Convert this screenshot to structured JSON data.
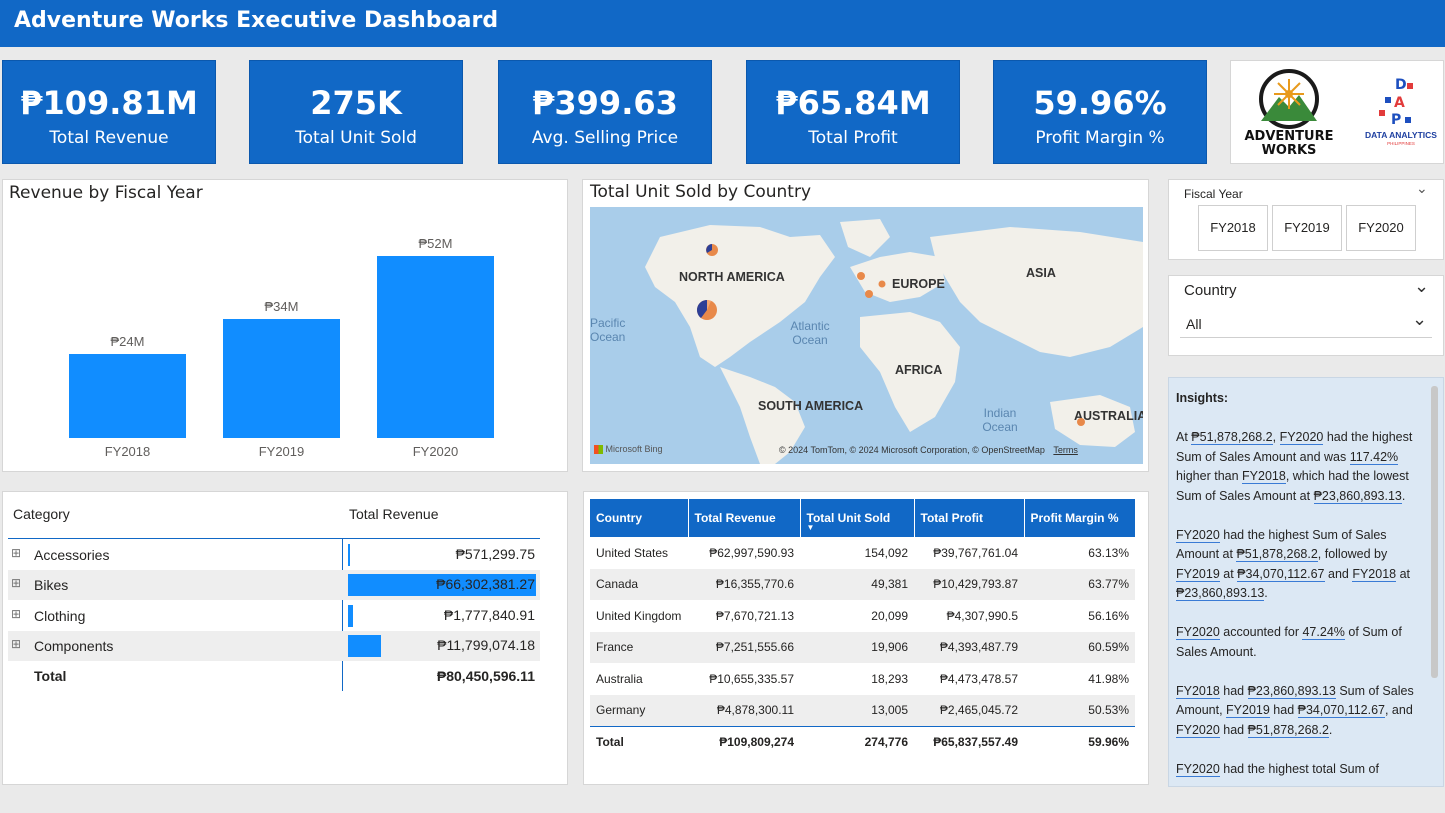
{
  "header": {
    "title": "Adventure Works Executive Dashboard"
  },
  "kpis": [
    {
      "value": "₱109.81M",
      "label": "Total Revenue"
    },
    {
      "value": "275K",
      "label": "Total Unit Sold"
    },
    {
      "value": "₱399.63",
      "label": "Avg. Selling Price"
    },
    {
      "value": "₱65.84M",
      "label": "Total Profit"
    },
    {
      "value": "59.96%",
      "label": "Profit Margin %"
    }
  ],
  "logos": {
    "adventure_works": [
      "ADVENTURE",
      "WORKS"
    ],
    "dap_letters": [
      "D",
      "A",
      "P"
    ],
    "dap_name": "DATA ANALYTICS",
    "dap_sub": "PHILIPPINES"
  },
  "revenue_chart": {
    "title": "Revenue by Fiscal Year",
    "bar_color": "#118dff"
  },
  "chart_data": {
    "type": "bar",
    "categories": [
      "FY2018",
      "FY2019",
      "FY2020"
    ],
    "values": [
      24,
      34,
      52
    ],
    "data_labels": [
      "₱24M",
      "₱34M",
      "₱52M"
    ],
    "title": "Revenue by Fiscal Year",
    "xlabel": "",
    "ylabel": "",
    "ylim": [
      0,
      60
    ],
    "grid": false
  },
  "map": {
    "title": "Total Unit Sold by Country",
    "continents": [
      "NORTH AMERICA",
      "EUROPE",
      "ASIA",
      "AFRICA",
      "SOUTH AMERICA",
      "AUSTRALIA"
    ],
    "oceans": [
      "Pacific Ocean",
      "Atlantic Ocean",
      "Indian Ocean"
    ],
    "attribution": "© 2024 TomTom, © 2024 Microsoft Corporation, © OpenStreetMap",
    "terms": "Terms",
    "bing": "Microsoft Bing"
  },
  "category_table": {
    "headers": [
      "Category",
      "Total Revenue"
    ],
    "rows": [
      {
        "name": "Accessories",
        "value": "₱571,299.75",
        "share": 0.0086
      },
      {
        "name": "Bikes",
        "value": "₱66,302,381.27",
        "share": 1.0
      },
      {
        "name": "Clothing",
        "value": "₱1,777,840.91",
        "share": 0.027
      },
      {
        "name": "Components",
        "value": "₱11,799,074.18",
        "share": 0.178
      }
    ],
    "total_label": "Total",
    "total_value": "₱80,450,596.11",
    "expand_glyph": "⊞"
  },
  "country_table": {
    "headers": [
      "Country",
      "Total Revenue",
      "Total Unit Sold",
      "Total Profit",
      "Profit Margin %"
    ],
    "sort_glyph": "▼",
    "rows": [
      [
        "United States",
        "₱62,997,590.93",
        "154,092",
        "₱39,767,761.04",
        "63.13%"
      ],
      [
        "Canada",
        "₱16,355,770.6",
        "49,381",
        "₱10,429,793.87",
        "63.77%"
      ],
      [
        "United Kingdom",
        "₱7,670,721.13",
        "20,099",
        "₱4,307,990.5",
        "56.16%"
      ],
      [
        "France",
        "₱7,251,555.66",
        "19,906",
        "₱4,393,487.79",
        "60.59%"
      ],
      [
        "Australia",
        "₱10,655,335.57",
        "18,293",
        "₱4,473,478.57",
        "41.98%"
      ],
      [
        "Germany",
        "₱4,878,300.11",
        "13,005",
        "₱2,465,045.72",
        "50.53%"
      ]
    ],
    "total": [
      "Total",
      "₱109,809,274",
      "274,776",
      "₱65,837,557.49",
      "59.96%"
    ]
  },
  "fiscal_slicer": {
    "title": "Fiscal Year",
    "options": [
      "FY2018",
      "FY2019",
      "FY2020"
    ]
  },
  "country_slicer": {
    "title": "Country",
    "selected": "All"
  },
  "insights": {
    "heading": "Insights:",
    "p1": [
      "At ",
      "₱51,878,268.2",
      ", ",
      "FY2020",
      " had the highest Sum of Sales Amount and was ",
      "117.42%",
      " higher than ",
      "FY2018",
      ", which had the lowest Sum of Sales Amount at ",
      "₱23,860,893.13",
      "."
    ],
    "p2": [
      "FY2020",
      " had the highest Sum of Sales Amount at ",
      "₱51,878,268.2",
      ", followed by ",
      "FY2019",
      " at ",
      "₱34,070,112.67",
      " and ",
      "FY2018",
      " at ",
      "₱23,860,893.13",
      "."
    ],
    "p3": [
      "FY2020",
      " accounted for ",
      "47.24%",
      " of Sum of Sales Amount."
    ],
    "p4": [
      "FY2018",
      " had ",
      "₱23,860,893.13",
      " Sum of Sales Amount, ",
      "FY2019",
      " had ",
      "₱34,070,112.67",
      ", and ",
      "FY2020",
      " had ",
      "₱51,878,268.2",
      "."
    ],
    "p5": [
      "FY2020",
      " had the highest total Sum of"
    ]
  }
}
